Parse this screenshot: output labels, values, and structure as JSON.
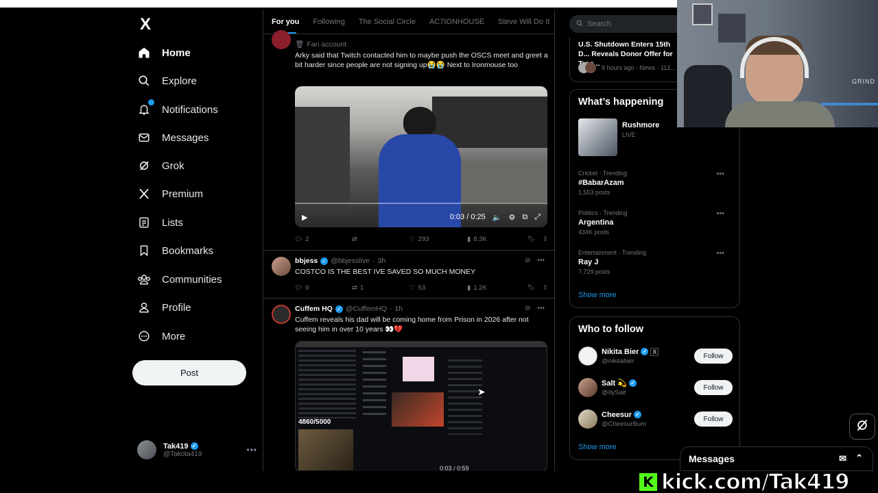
{
  "nav": {
    "logo": "X",
    "items": [
      {
        "label": "Home"
      },
      {
        "label": "Explore"
      },
      {
        "label": "Notifications"
      },
      {
        "label": "Messages"
      },
      {
        "label": "Grok"
      },
      {
        "label": "Premium"
      },
      {
        "label": "Lists"
      },
      {
        "label": "Bookmarks"
      },
      {
        "label": "Communities"
      },
      {
        "label": "Profile"
      },
      {
        "label": "More"
      }
    ],
    "notifications_badge": "1",
    "post_label": "Post",
    "account": {
      "name": "Tak419",
      "handle": "@Takota419"
    }
  },
  "tabs": [
    {
      "label": "For you"
    },
    {
      "label": "Following"
    },
    {
      "label": "The Social Circle"
    },
    {
      "label": "AC7IONHOUSE"
    },
    {
      "label": "Steve Will Do It"
    }
  ],
  "tweets": [
    {
      "badge": "Fan account",
      "text": "Arky said that Twitch contacted him to maybe push the OSCS meet and greet a bit harder since people are not signing up😭😭 Next to Ironmouse too",
      "video_time": "0:03 / 0:25",
      "replies": "2",
      "retweets": "",
      "likes": "293",
      "views": "8.3K"
    },
    {
      "name": "bbjess",
      "handle": "@bbjesslive",
      "time": "3h",
      "text": "COSTCO IS THE BEST IVE SAVED SO MUCH MONEY",
      "replies": "9",
      "retweets": "1",
      "likes": "53",
      "views": "1.2K"
    },
    {
      "name": "Cuffem HQ",
      "handle": "@CuffemHQ",
      "time": "1h",
      "text": "Cuffem reveals his dad will be coming home from Prison in 2026 after not seeing him in over 10 years 👀💔",
      "screen_counter": "4860/5000",
      "video_time": "0:03 / 0:59"
    }
  ],
  "search": {
    "placeholder": "Search"
  },
  "news": {
    "title": "U.S. Shutdown Enters 15th D... Reveals Donor Offer for Troo...",
    "meta": "8 hours ago · News · 112..."
  },
  "whats_happening": {
    "title": "What’s happening",
    "live": {
      "name": "Rushmore",
      "status": "LIVE"
    },
    "trends": [
      {
        "context": "Cricket · Trending",
        "title": "#BabarAzam",
        "count": "1,553 posts"
      },
      {
        "context": "Politics · Trending",
        "title": "Argentina",
        "count": "434K posts"
      },
      {
        "context": "Entertainment · Trending",
        "title": "Ray J",
        "count": "7,729 posts"
      }
    ],
    "show_more": "Show more"
  },
  "who_to_follow": {
    "title": "Who to follow",
    "users": [
      {
        "name": "Nikita Bier",
        "handle": "@nikitabier",
        "button": "Follow"
      },
      {
        "name": "Salt 💫",
        "handle": "@IlySalt",
        "button": "Follow"
      },
      {
        "name": "Cheesur",
        "handle": "@CheesurBum",
        "button": "Follow"
      }
    ],
    "show_more": "Show more"
  },
  "messages_drawer": {
    "label": "Messages"
  },
  "overlay": {
    "kick_url": "kick.com/Tak419",
    "kick_logo": "K",
    "webcam_sign": "GRIND"
  },
  "colors": {
    "accent": "#1d9bf0",
    "kick": "#53fc18",
    "background": "#000000"
  }
}
